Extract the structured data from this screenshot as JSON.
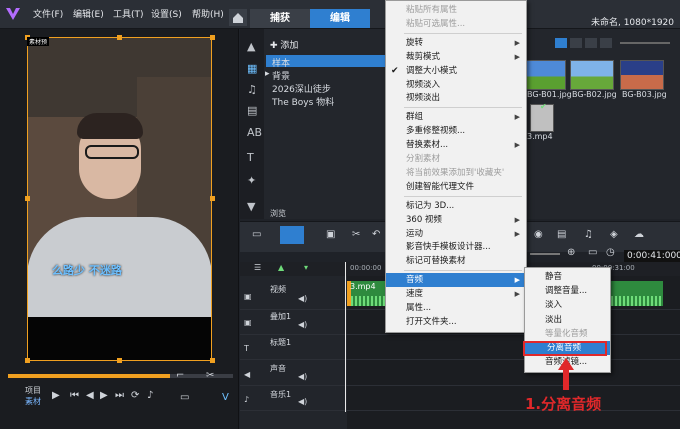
{
  "menubar": {
    "items": [
      "文件(F)",
      "编辑(E)",
      "工具(T)",
      "设置(S)",
      "帮助(H)"
    ],
    "tabs": {
      "capture": "捕获",
      "edit": "编辑"
    },
    "window_title": "未命名, 1080*1920"
  },
  "preview": {
    "tiny_label": "素材预",
    "subtitle": "么路少 不迷路",
    "project_label": "项目",
    "clip_label": "素材"
  },
  "library": {
    "add_label": "添加",
    "folders": [
      "样本",
      "背景",
      "2026深山徒步",
      "The Boys 物料"
    ],
    "thumbs": [
      {
        "label": "BG-B01.jpg"
      },
      {
        "label": "BG-B02.jpg"
      },
      {
        "label": "BG-B03.jpg"
      },
      {
        "label": "3.mp4"
      }
    ],
    "browse_label": "浏览"
  },
  "timeline": {
    "timecode": "0:00:41:000",
    "ruler": [
      "00:00:00",
      "00:00:31:00"
    ],
    "tracks": [
      "视频",
      "叠加1",
      "标题1",
      "声音",
      "音乐1"
    ],
    "clip_name": "3.mp4"
  },
  "context_menu": {
    "items": [
      {
        "label": "粘贴所有属性",
        "disabled": true
      },
      {
        "label": "粘贴可选属性...",
        "disabled": true
      },
      {
        "sep": true
      },
      {
        "label": "旋转",
        "submenu": true
      },
      {
        "label": "裁剪模式",
        "submenu": true
      },
      {
        "label": "调整大小模式",
        "checked": true
      },
      {
        "label": "视频淡入"
      },
      {
        "label": "视频淡出"
      },
      {
        "sep": true
      },
      {
        "label": "群组",
        "submenu": true
      },
      {
        "label": "多重修整视频..."
      },
      {
        "label": "替换素材...",
        "submenu": true
      },
      {
        "label": "分割素材",
        "disabled": true
      },
      {
        "label": "将当前效果添加到'收藏夹'",
        "disabled": true
      },
      {
        "label": "创建智能代理文件"
      },
      {
        "sep": true
      },
      {
        "label": "标记为 3D..."
      },
      {
        "label": "360 视频",
        "submenu": true
      },
      {
        "label": "运动",
        "submenu": true
      },
      {
        "label": "影音快手模板设计器..."
      },
      {
        "label": "标记可替换素材"
      },
      {
        "sep": true
      },
      {
        "label": "音频",
        "submenu": true,
        "highlight": true
      },
      {
        "label": "速度",
        "submenu": true
      },
      {
        "label": "属性..."
      },
      {
        "label": "打开文件夹..."
      }
    ]
  },
  "submenu": {
    "items": [
      {
        "label": "静音"
      },
      {
        "label": "调整音量..."
      },
      {
        "label": "淡入"
      },
      {
        "label": "淡出"
      },
      {
        "label": "等量化音频",
        "disabled": true
      },
      {
        "label": "分离音频",
        "highlight": true
      },
      {
        "label": "音频滤镜..."
      }
    ]
  },
  "annotation": "1.分离音频",
  "colors": {
    "accent": "#2f7fd0",
    "annotation": "#e0282a",
    "clip": "#2e8a3e"
  }
}
